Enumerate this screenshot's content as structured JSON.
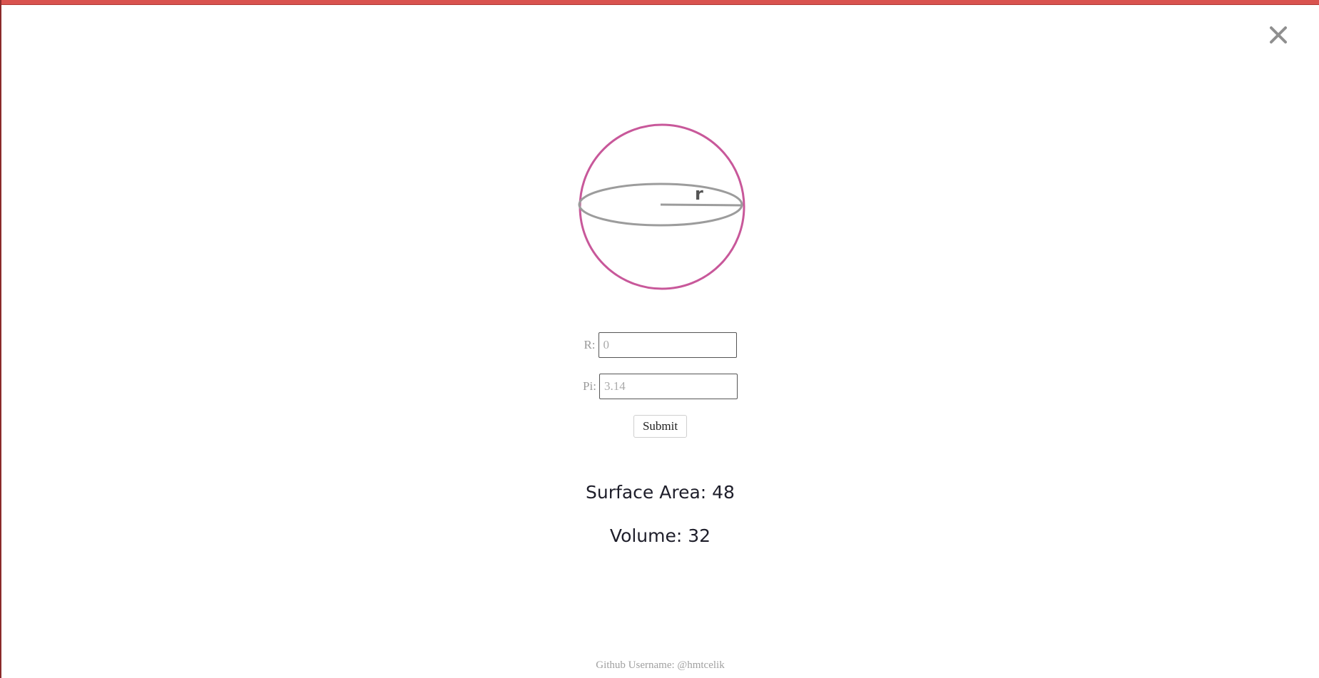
{
  "colors": {
    "top_bar": "#d9534f",
    "sphere_outline": "#c8589a",
    "equator": "#9c9c9c"
  },
  "close_icon": "close-icon",
  "diagram": {
    "radius_label": "r"
  },
  "form": {
    "r_label": "R:",
    "r_placeholder": "0",
    "pi_label": "Pi:",
    "pi_placeholder": "3.14",
    "submit_label": "Submit"
  },
  "results": {
    "surface_area": "Surface Area: 48",
    "volume": "Volume: 32"
  },
  "footer": {
    "text": "Github Username: @hmtcelik"
  }
}
